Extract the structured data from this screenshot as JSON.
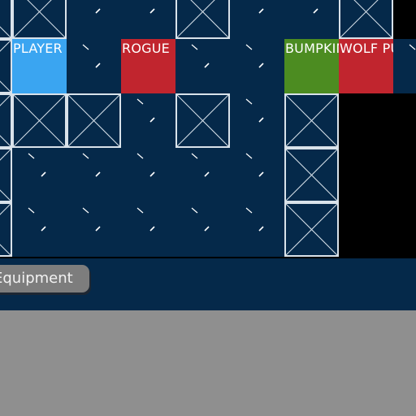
{
  "game": {
    "title": "",
    "colors": {
      "floor": "#05294a",
      "wall_border": "#d9e2ea",
      "void": "#000000",
      "player": "#3aa5f1",
      "hostile": "#c1252e",
      "friendly": "#4c8c21",
      "hud_background": "#05294a",
      "bottom_panel": "#8f8f8f"
    },
    "grid": {
      "legend": {
        ".": "floor",
        "W": "wall",
        "#": "void"
      },
      "rows": [
        "W..W..W#",
        "........",
        "WW.W.W##",
        ".....W##",
        ".....W##"
      ],
      "entities": [
        {
          "name": "player",
          "label": "PLAYER",
          "row": 1,
          "col": 0,
          "type": "player",
          "color": "#3aa5f1"
        },
        {
          "name": "rogue",
          "label": "ROGUE",
          "row": 1,
          "col": 2,
          "type": "enemy",
          "color": "#c1252e"
        },
        {
          "name": "bumpkin",
          "label": "BUMPKIN",
          "row": 1,
          "col": 5,
          "type": "friendly",
          "color": "#4c8c21"
        },
        {
          "name": "wolf-pup",
          "label": "WOLF PUP",
          "row": 1,
          "col": 6,
          "type": "enemy",
          "color": "#c1252e"
        }
      ]
    },
    "hud": {
      "equipment_button": "Equipment"
    }
  }
}
